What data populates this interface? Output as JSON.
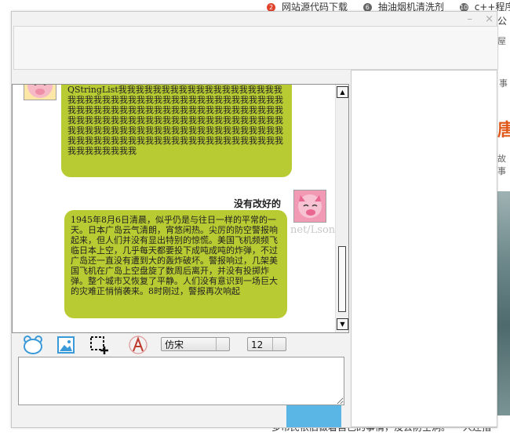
{
  "background": {
    "top_items": [
      {
        "badge": "2",
        "badge_color": "#e0432a",
        "text": "网站源代码下载"
      },
      {
        "badge": "6",
        "badge_color": "#666666",
        "text": "抽油烟机清洗剂"
      },
      {
        "badge": "10",
        "badge_color": "#666666",
        "text": "c++程序设计"
      }
    ],
    "snippet_1": "公",
    "snippet_2": "屋",
    "snippet_3": "事",
    "snippet_4": "唐",
    "snippet_5": "故事",
    "bottom_text": "多市民依旧做着自己的事情，没去防空洞。 一人还指"
  },
  "window": {
    "minimize_label": "–",
    "close_label": "×"
  },
  "chat": {
    "message1": {
      "text": "QStringList我我我我我我我我我我我我我我我我我我我我我我我我我我我我我我我我我我我我我我我我我我我我我我我我我我我我我我我我我我我我我我我我我我我我我我我我我我我我我我我我我我我我我我我我我我我我我我我我我我我我我我我我我我我我我我我我我我我我我我我我我我我我我我我我我我我我我我我我我我我我我我我我我我我我我我我我"
    },
    "message2": {
      "sender": "没有改好的",
      "text": "1945年8月6日清晨，似乎仍是与往日一样的平常的一天。日本广岛云气清朗，宵悠闲热。尖厉的防空警报响起来，但人们并没有显出特别的惊慌。美国飞机频频飞临日本上空，几乎每天都要投下成吨成吨的炸弹，不过广岛还一直没有遭到大的轰炸破坏。警报响过，几架美国飞机在广岛上空盘旋了数周后离开，并没有投掷炸弹。整个城市又恢复了平静。人们没有意识到一场巨大的灾难正悄悄袭来。8时刚过，警报再次响起"
    },
    "watermark": "net/Lsonpo"
  },
  "toolbar": {
    "font_value": "仿宋",
    "size_value": "12"
  },
  "input": {
    "value": ""
  },
  "colors": {
    "bubble": "#b9cb33",
    "send_button": "#5ab6e4",
    "tool_icon": "#3a9ad9"
  }
}
